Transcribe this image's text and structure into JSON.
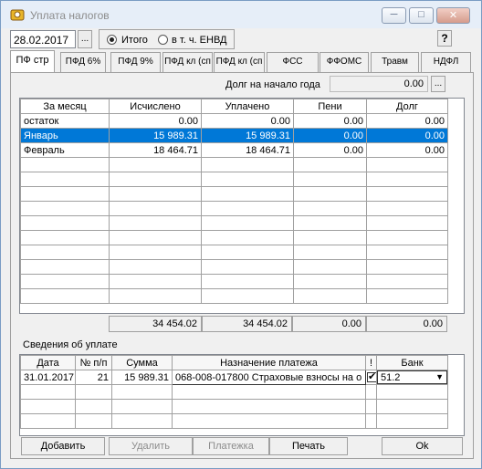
{
  "window": {
    "title": "Уплата налогов"
  },
  "toolbar": {
    "date_value": "28.02.2017",
    "dots_label": "...",
    "radio_total": "Итого",
    "radio_envd": "в т. ч. ЕНВД",
    "help_label": "?"
  },
  "tabs": [
    "ПФ стр",
    "ПФД 6%",
    "ПФД 9%",
    "ПФД кл (сп",
    "ПФД кл (сп",
    "ФСС",
    "ФФОМС",
    "Травм",
    "НДФЛ"
  ],
  "debt": {
    "label": "Долг на начало года",
    "value": "0.00",
    "dots_label": "..."
  },
  "accruals": {
    "headers": [
      "За месяц",
      "Исчислено",
      "Уплачено",
      "Пени",
      "Долг"
    ],
    "rows": [
      [
        "остаток",
        "0.00",
        "0.00",
        "0.00",
        "0.00"
      ],
      [
        "Январь",
        "15 989.31",
        "15 989.31",
        "0.00",
        "0.00"
      ],
      [
        "Февраль",
        "18 464.71",
        "18 464.71",
        "0.00",
        "0.00"
      ]
    ],
    "totals": [
      "34 454.02",
      "34 454.02",
      "0.00",
      "0.00"
    ]
  },
  "payments": {
    "label": "Сведения об уплате",
    "headers": [
      "Дата",
      "№ п/п",
      "Сумма",
      "Назначение платежа",
      "!",
      "Банк"
    ],
    "rows": [
      {
        "date": "31.01.2017",
        "num": "21",
        "sum": "15 989.31",
        "purpose": "068-008-017800 Страховые взносы на о",
        "bank": "51.2"
      }
    ]
  },
  "buttons": {
    "add": "Добавить",
    "delete": "Удалить",
    "payments": "Платежка",
    "print": "Печать",
    "ok": "Ok"
  }
}
